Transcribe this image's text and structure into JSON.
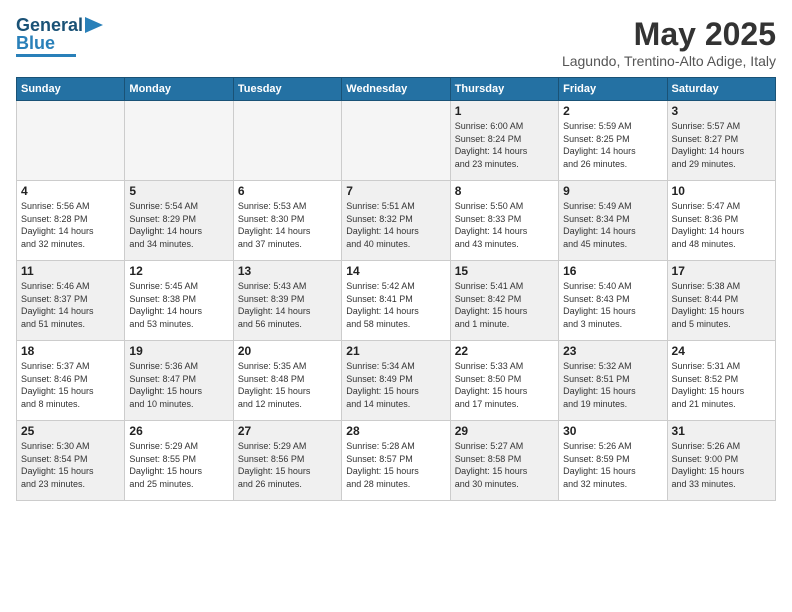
{
  "header": {
    "logo_line1": "General",
    "logo_line2": "Blue",
    "month_year": "May 2025",
    "location": "Lagundo, Trentino-Alto Adige, Italy"
  },
  "days_of_week": [
    "Sunday",
    "Monday",
    "Tuesday",
    "Wednesday",
    "Thursday",
    "Friday",
    "Saturday"
  ],
  "weeks": [
    [
      {
        "day": "",
        "empty": true
      },
      {
        "day": "",
        "empty": true
      },
      {
        "day": "",
        "empty": true
      },
      {
        "day": "",
        "empty": true
      },
      {
        "day": "1",
        "text": "Sunrise: 6:00 AM\nSunset: 8:24 PM\nDaylight: 14 hours\nand 23 minutes."
      },
      {
        "day": "2",
        "text": "Sunrise: 5:59 AM\nSunset: 8:25 PM\nDaylight: 14 hours\nand 26 minutes."
      },
      {
        "day": "3",
        "text": "Sunrise: 5:57 AM\nSunset: 8:27 PM\nDaylight: 14 hours\nand 29 minutes."
      }
    ],
    [
      {
        "day": "4",
        "text": "Sunrise: 5:56 AM\nSunset: 8:28 PM\nDaylight: 14 hours\nand 32 minutes."
      },
      {
        "day": "5",
        "text": "Sunrise: 5:54 AM\nSunset: 8:29 PM\nDaylight: 14 hours\nand 34 minutes."
      },
      {
        "day": "6",
        "text": "Sunrise: 5:53 AM\nSunset: 8:30 PM\nDaylight: 14 hours\nand 37 minutes."
      },
      {
        "day": "7",
        "text": "Sunrise: 5:51 AM\nSunset: 8:32 PM\nDaylight: 14 hours\nand 40 minutes."
      },
      {
        "day": "8",
        "text": "Sunrise: 5:50 AM\nSunset: 8:33 PM\nDaylight: 14 hours\nand 43 minutes."
      },
      {
        "day": "9",
        "text": "Sunrise: 5:49 AM\nSunset: 8:34 PM\nDaylight: 14 hours\nand 45 minutes."
      },
      {
        "day": "10",
        "text": "Sunrise: 5:47 AM\nSunset: 8:36 PM\nDaylight: 14 hours\nand 48 minutes."
      }
    ],
    [
      {
        "day": "11",
        "text": "Sunrise: 5:46 AM\nSunset: 8:37 PM\nDaylight: 14 hours\nand 51 minutes."
      },
      {
        "day": "12",
        "text": "Sunrise: 5:45 AM\nSunset: 8:38 PM\nDaylight: 14 hours\nand 53 minutes."
      },
      {
        "day": "13",
        "text": "Sunrise: 5:43 AM\nSunset: 8:39 PM\nDaylight: 14 hours\nand 56 minutes."
      },
      {
        "day": "14",
        "text": "Sunrise: 5:42 AM\nSunset: 8:41 PM\nDaylight: 14 hours\nand 58 minutes."
      },
      {
        "day": "15",
        "text": "Sunrise: 5:41 AM\nSunset: 8:42 PM\nDaylight: 15 hours\nand 1 minute."
      },
      {
        "day": "16",
        "text": "Sunrise: 5:40 AM\nSunset: 8:43 PM\nDaylight: 15 hours\nand 3 minutes."
      },
      {
        "day": "17",
        "text": "Sunrise: 5:38 AM\nSunset: 8:44 PM\nDaylight: 15 hours\nand 5 minutes."
      }
    ],
    [
      {
        "day": "18",
        "text": "Sunrise: 5:37 AM\nSunset: 8:46 PM\nDaylight: 15 hours\nand 8 minutes."
      },
      {
        "day": "19",
        "text": "Sunrise: 5:36 AM\nSunset: 8:47 PM\nDaylight: 15 hours\nand 10 minutes."
      },
      {
        "day": "20",
        "text": "Sunrise: 5:35 AM\nSunset: 8:48 PM\nDaylight: 15 hours\nand 12 minutes."
      },
      {
        "day": "21",
        "text": "Sunrise: 5:34 AM\nSunset: 8:49 PM\nDaylight: 15 hours\nand 14 minutes."
      },
      {
        "day": "22",
        "text": "Sunrise: 5:33 AM\nSunset: 8:50 PM\nDaylight: 15 hours\nand 17 minutes."
      },
      {
        "day": "23",
        "text": "Sunrise: 5:32 AM\nSunset: 8:51 PM\nDaylight: 15 hours\nand 19 minutes."
      },
      {
        "day": "24",
        "text": "Sunrise: 5:31 AM\nSunset: 8:52 PM\nDaylight: 15 hours\nand 21 minutes."
      }
    ],
    [
      {
        "day": "25",
        "text": "Sunrise: 5:30 AM\nSunset: 8:54 PM\nDaylight: 15 hours\nand 23 minutes."
      },
      {
        "day": "26",
        "text": "Sunrise: 5:29 AM\nSunset: 8:55 PM\nDaylight: 15 hours\nand 25 minutes."
      },
      {
        "day": "27",
        "text": "Sunrise: 5:29 AM\nSunset: 8:56 PM\nDaylight: 15 hours\nand 26 minutes."
      },
      {
        "day": "28",
        "text": "Sunrise: 5:28 AM\nSunset: 8:57 PM\nDaylight: 15 hours\nand 28 minutes."
      },
      {
        "day": "29",
        "text": "Sunrise: 5:27 AM\nSunset: 8:58 PM\nDaylight: 15 hours\nand 30 minutes."
      },
      {
        "day": "30",
        "text": "Sunrise: 5:26 AM\nSunset: 8:59 PM\nDaylight: 15 hours\nand 32 minutes."
      },
      {
        "day": "31",
        "text": "Sunrise: 5:26 AM\nSunset: 9:00 PM\nDaylight: 15 hours\nand 33 minutes."
      }
    ]
  ]
}
